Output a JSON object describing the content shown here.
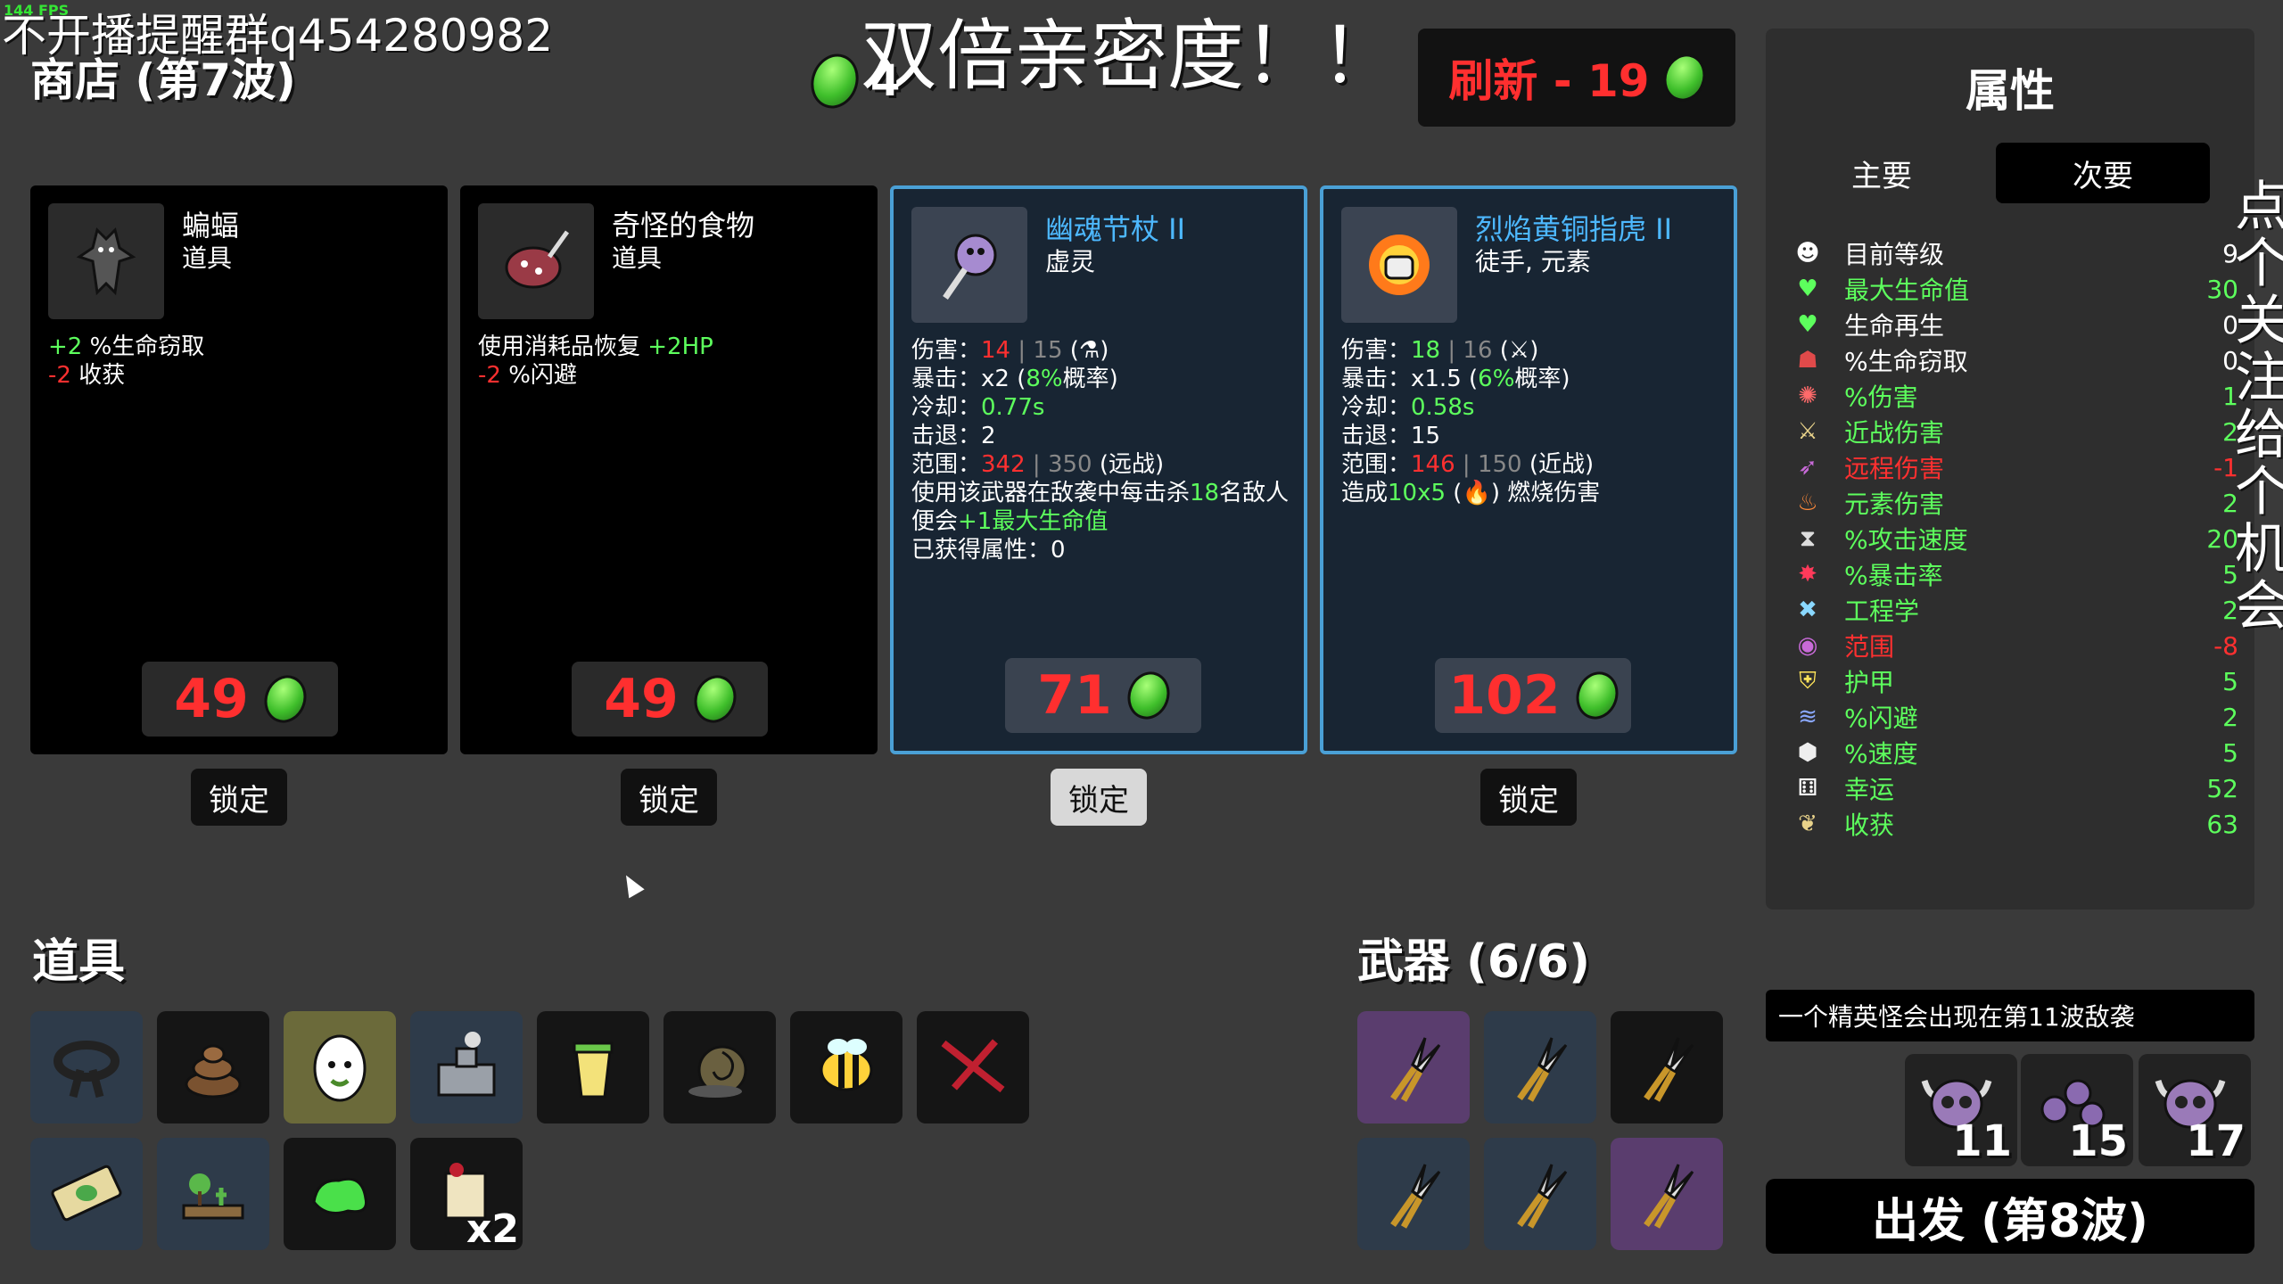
{
  "fps": "144 FPS",
  "overlay_top": "不开播提醒群q454280982",
  "overlay_center": "双倍亲密度！！",
  "overlay_vertical": "点个关注，给个机会",
  "shop": {
    "title": "商店 (第7波)",
    "materials": "4"
  },
  "reroll": {
    "label": "刷新 - 19"
  },
  "cards": [
    {
      "name": "蝙蝠",
      "type": "道具",
      "lines": [
        [
          {
            "t": "+2",
            "c": "g"
          },
          {
            "t": " %生命窃取"
          }
        ],
        [
          {
            "t": "-2",
            "c": "r"
          },
          {
            "t": " 收获"
          }
        ]
      ],
      "price": "49",
      "lock": "锁定",
      "weapon": false,
      "icon": "bat-icon"
    },
    {
      "name": "奇怪的食物",
      "type": "道具",
      "lines": [
        [
          {
            "t": "使用消耗品恢复 "
          },
          {
            "t": "+2HP",
            "c": "g"
          }
        ],
        [
          {
            "t": "-2",
            "c": "r"
          },
          {
            "t": " %闪避"
          }
        ]
      ],
      "price": "49",
      "lock": "锁定",
      "weapon": false,
      "icon": "strange-food-icon"
    },
    {
      "name": "幽魂节杖 II",
      "type": "虚灵",
      "lines": [
        [
          {
            "t": "伤害："
          },
          {
            "t": "14",
            "c": "r"
          },
          {
            "t": " | 15",
            "c": "dim"
          },
          {
            "t": " (⚗)"
          }
        ],
        [
          {
            "t": "暴击：x2 ("
          },
          {
            "t": "8%",
            "c": "g"
          },
          {
            "t": "概率)"
          }
        ],
        [
          {
            "t": "冷却："
          },
          {
            "t": "0.77s",
            "c": "g"
          }
        ],
        [
          {
            "t": "击退：2"
          }
        ],
        [
          {
            "t": "范围："
          },
          {
            "t": "342",
            "c": "r"
          },
          {
            "t": " | 350",
            "c": "dim"
          },
          {
            "t": " (远战)"
          }
        ],
        [
          {
            "t": "使用该武器在敌袭中每击杀"
          },
          {
            "t": "18",
            "c": "g"
          },
          {
            "t": "名敌人"
          }
        ],
        [
          {
            "t": "便会"
          },
          {
            "t": "+1最大生命值",
            "c": "g"
          }
        ],
        [
          {
            "t": "已获得属性：0"
          }
        ]
      ],
      "price": "71",
      "lock": "锁定",
      "weapon": true,
      "icon": "ghost-scepter-icon"
    },
    {
      "name": "烈焰黄铜指虎 II",
      "type": "徒手, 元素",
      "lines": [
        [
          {
            "t": "伤害："
          },
          {
            "t": "18",
            "c": "g"
          },
          {
            "t": " | 16",
            "c": "dim"
          },
          {
            "t": " (⚔)"
          }
        ],
        [
          {
            "t": "暴击：x1.5 ("
          },
          {
            "t": "6%",
            "c": "g"
          },
          {
            "t": "概率)"
          }
        ],
        [
          {
            "t": "冷却："
          },
          {
            "t": "0.58s",
            "c": "g"
          }
        ],
        [
          {
            "t": "击退：15"
          }
        ],
        [
          {
            "t": "范围："
          },
          {
            "t": "146",
            "c": "r"
          },
          {
            "t": " | 150",
            "c": "dim"
          },
          {
            "t": " (近战)"
          }
        ],
        [
          {
            "t": "造成"
          },
          {
            "t": "10x5",
            "c": "g"
          },
          {
            "t": " (🔥) 燃烧伤害"
          }
        ]
      ],
      "price": "102",
      "lock": "锁定",
      "weapon": true,
      "icon": "flaming-knuckles-icon"
    }
  ],
  "items_section": {
    "title": "道具"
  },
  "items": [
    {
      "icon": "black-belt-icon",
      "bg": "blue"
    },
    {
      "icon": "poop-icon",
      "bg": "dark"
    },
    {
      "icon": "egg-icon",
      "bg": "yellow"
    },
    {
      "icon": "ruined-city-icon",
      "bg": "blue"
    },
    {
      "icon": "lemonade-icon",
      "bg": "dark"
    },
    {
      "icon": "snail-icon",
      "bg": "dark"
    },
    {
      "icon": "bee-icon",
      "bg": "dark"
    },
    {
      "icon": "red-scar-icon",
      "bg": "dark"
    },
    {
      "icon": "banknote-icon",
      "bg": "blue"
    },
    {
      "icon": "garden-icon",
      "bg": "blue"
    },
    {
      "icon": "green-slime-icon",
      "bg": "dark"
    },
    {
      "icon": "scroll-icon",
      "bg": "dark",
      "qty": "x2"
    }
  ],
  "weapons_section": {
    "title": "武器 (6/6)"
  },
  "weapons": [
    {
      "icon": "pruner-icon",
      "bg": "purple"
    },
    {
      "icon": "pruner-icon",
      "bg": "blue"
    },
    {
      "icon": "pruner-icon",
      "bg": "dark"
    },
    {
      "icon": "pruner-icon",
      "bg": "blue"
    },
    {
      "icon": "pruner-icon",
      "bg": "blue"
    },
    {
      "icon": "pruner-icon",
      "bg": "purple"
    }
  ],
  "stats_panel": {
    "title": "属性",
    "tab_primary": "主要",
    "tab_secondary": "次要",
    "rows": [
      {
        "label": "目前等级",
        "value": "9",
        "color": "#ffffff",
        "icon": "level-icon",
        "glyph": "☻",
        "vcolor": "#ffffff"
      },
      {
        "label": "最大生命值",
        "value": "30",
        "color": "#5dff5d",
        "icon": "heart-icon",
        "glyph": "♥",
        "vcolor": "#5dff5d",
        "gcolor": "#5dff5d"
      },
      {
        "label": "生命再生",
        "value": "0",
        "color": "#ffffff",
        "icon": "heart-plus-icon",
        "glyph": "♥",
        "vcolor": "#ffffff",
        "gcolor": "#5dff5d"
      },
      {
        "label": "%生命窃取",
        "value": "0",
        "color": "#ffffff",
        "icon": "fangs-icon",
        "glyph": "☗",
        "vcolor": "#ffffff",
        "gcolor": "#e04a4a"
      },
      {
        "label": "%伤害",
        "value": "1",
        "color": "#5dff5d",
        "icon": "brain-icon",
        "glyph": "✺",
        "vcolor": "#5dff5d",
        "gcolor": "#ff6a6a"
      },
      {
        "label": "近战伤害",
        "value": "2",
        "color": "#5dff5d",
        "icon": "sword-icon",
        "glyph": "⚔",
        "vcolor": "#5dff5d",
        "gcolor": "#e8d28a"
      },
      {
        "label": "远程伤害",
        "value": "-1",
        "color": "#ff3030",
        "icon": "bow-icon",
        "glyph": "➶",
        "vcolor": "#ff3030",
        "gcolor": "#c86ad8"
      },
      {
        "label": "元素伤害",
        "value": "2",
        "color": "#5dff5d",
        "icon": "flame-icon",
        "glyph": "♨",
        "vcolor": "#5dff5d",
        "gcolor": "#ff8a3a"
      },
      {
        "label": "%攻击速度",
        "value": "20",
        "color": "#5dff5d",
        "icon": "hourglass-icon",
        "glyph": "⧗",
        "vcolor": "#5dff5d",
        "gcolor": "#dddddd"
      },
      {
        "label": "%暴击率",
        "value": "5",
        "color": "#5dff5d",
        "icon": "crit-burst-icon",
        "glyph": "✸",
        "vcolor": "#5dff5d",
        "gcolor": "#ff3a5a"
      },
      {
        "label": "工程学",
        "value": "2",
        "color": "#5dff5d",
        "icon": "wrench-icon",
        "glyph": "✖",
        "vcolor": "#5dff5d",
        "gcolor": "#8ad8ff"
      },
      {
        "label": "范围",
        "value": "-8",
        "color": "#ff3030",
        "icon": "range-icon",
        "glyph": "◉",
        "vcolor": "#ff3030",
        "gcolor": "#c86ad8"
      },
      {
        "label": "护甲",
        "value": "5",
        "color": "#5dff5d",
        "icon": "shield-icon",
        "glyph": "⛨",
        "vcolor": "#5dff5d",
        "gcolor": "#ffe45a"
      },
      {
        "label": "%闪避",
        "value": "2",
        "color": "#5dff5d",
        "icon": "dodge-icon",
        "glyph": "≋",
        "vcolor": "#5dff5d",
        "gcolor": "#8aa8ff"
      },
      {
        "label": "%速度",
        "value": "5",
        "color": "#5dff5d",
        "icon": "boot-icon",
        "glyph": "⬢",
        "vcolor": "#5dff5d",
        "gcolor": "#eeeeee"
      },
      {
        "label": "幸运",
        "value": "52",
        "color": "#5dff5d",
        "icon": "dice-icon",
        "glyph": "⚅",
        "vcolor": "#5dff5d",
        "gcolor": "#ffffff"
      },
      {
        "label": "收获",
        "value": "63",
        "color": "#5dff5d",
        "icon": "wheat-icon",
        "glyph": "❦",
        "vcolor": "#5dff5d",
        "gcolor": "#e8d28a"
      }
    ]
  },
  "elite_notice": "一个精英怪会出现在第11波敌袭",
  "enemies": [
    {
      "icon": "horned-skull-icon",
      "count": "11"
    },
    {
      "icon": "skull-swarm-icon",
      "count": "15"
    },
    {
      "icon": "horned-skull-icon",
      "count": "17"
    }
  ],
  "go_button": "出发 (第8波)",
  "colors": {
    "price_red": "#ff2f2f",
    "stat_green": "#5dff5d",
    "weapon_border": "#4aa0d6",
    "weapon_name": "#4db8ff"
  }
}
